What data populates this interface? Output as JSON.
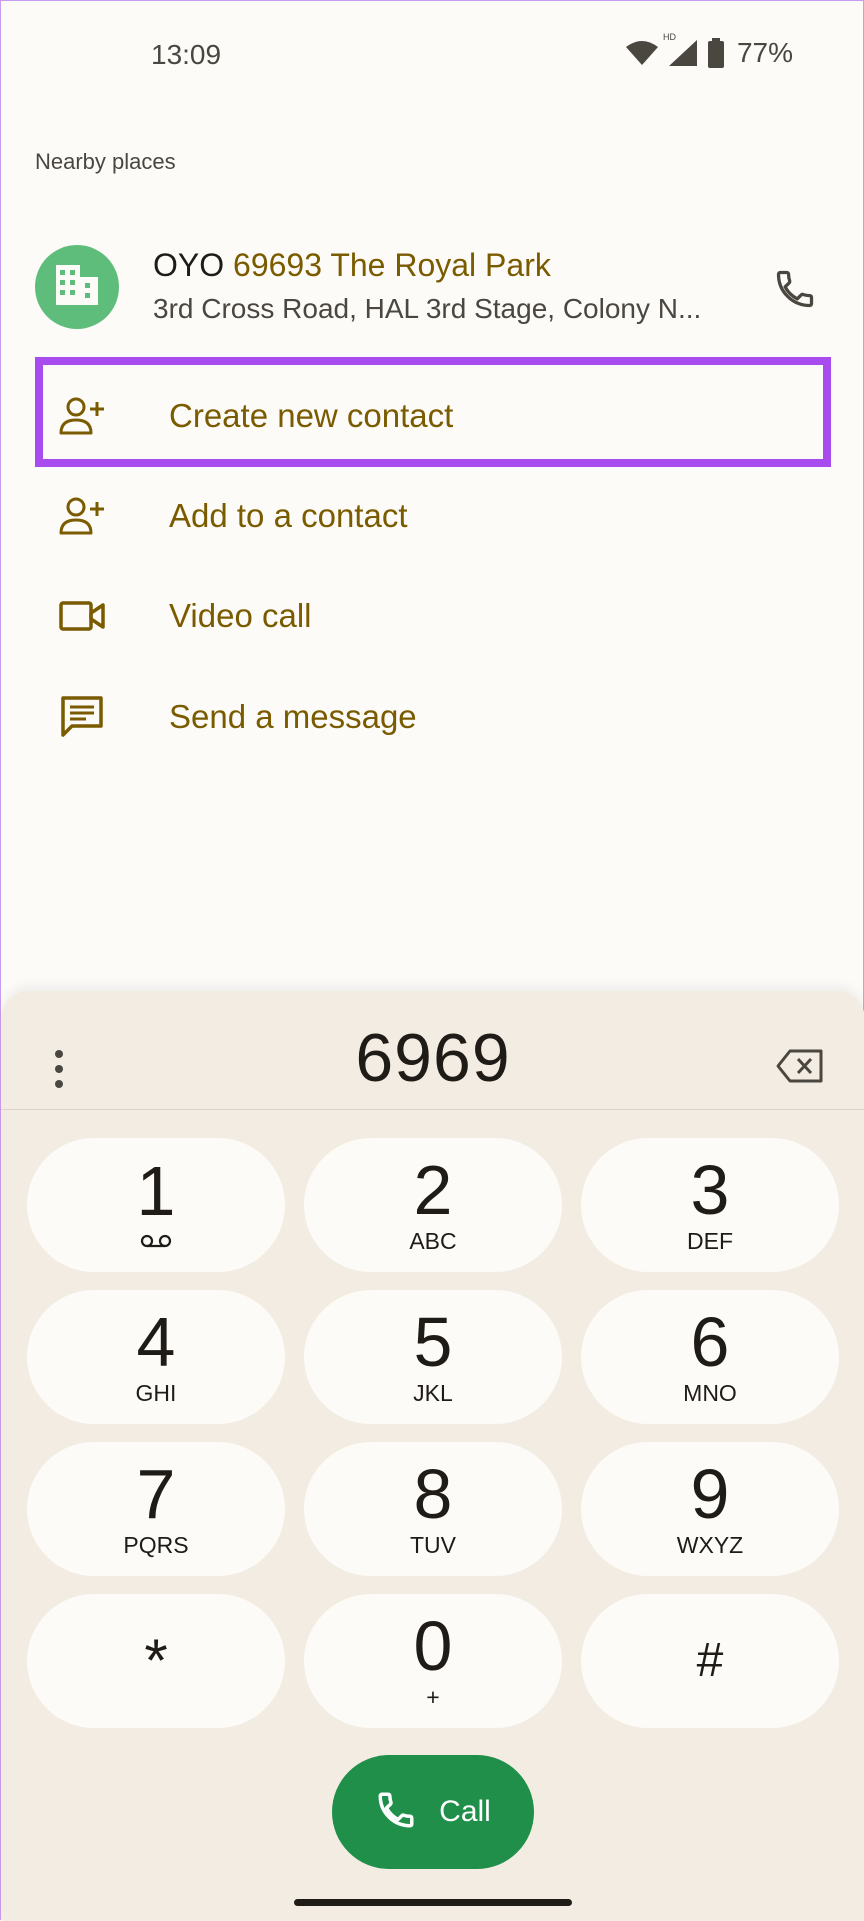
{
  "status_bar": {
    "time": "13:09",
    "hd_badge": "HD",
    "battery": "77%"
  },
  "section": {
    "title": "Nearby places"
  },
  "place": {
    "name_prefix": "OYO ",
    "name_match": "69693 The Royal Park",
    "address": "3rd Cross Road, HAL 3rd Stage, Colony N..."
  },
  "actions": [
    {
      "label": "Create new contact",
      "icon": "person-add-icon"
    },
    {
      "label": "Add to a contact",
      "icon": "person-add-icon"
    },
    {
      "label": "Video call",
      "icon": "videocam-icon"
    },
    {
      "label": "Send a message",
      "icon": "message-icon"
    }
  ],
  "dialpad": {
    "number": "6969",
    "keys": [
      {
        "digit": "1",
        "letters": ""
      },
      {
        "digit": "2",
        "letters": "ABC"
      },
      {
        "digit": "3",
        "letters": "DEF"
      },
      {
        "digit": "4",
        "letters": "GHI"
      },
      {
        "digit": "5",
        "letters": "JKL"
      },
      {
        "digit": "6",
        "letters": "MNO"
      },
      {
        "digit": "7",
        "letters": "PQRS"
      },
      {
        "digit": "8",
        "letters": "TUV"
      },
      {
        "digit": "9",
        "letters": "WXYZ"
      },
      {
        "digit": "*",
        "letters": ""
      },
      {
        "digit": "0",
        "letters": "+"
      },
      {
        "digit": "#",
        "letters": ""
      }
    ],
    "call_label": "Call"
  },
  "colors": {
    "accent": "#7a5b00",
    "highlight": "#a84cf0",
    "call_green": "#1f8f4a",
    "place_avatar": "#5fbd7c"
  }
}
